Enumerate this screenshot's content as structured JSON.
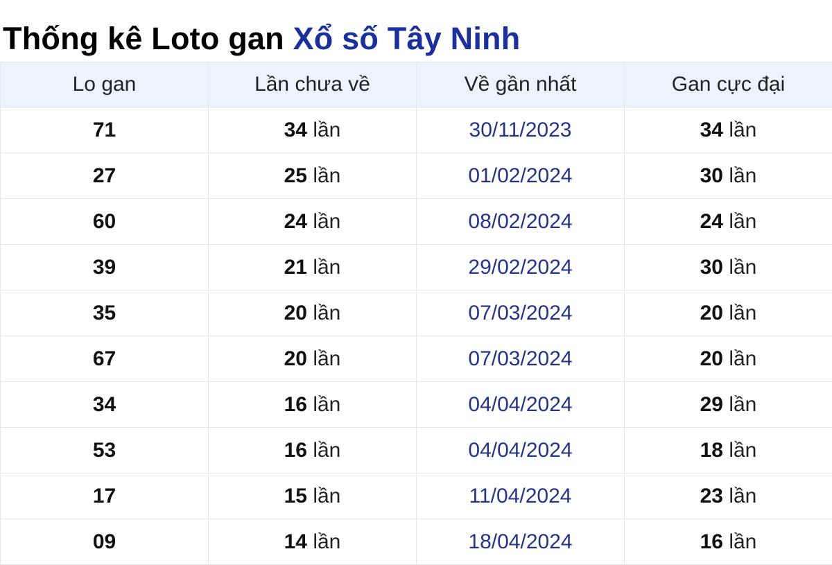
{
  "title": {
    "prefix": "Thống kê Loto gan",
    "link_text": "Xổ số Tây Ninh"
  },
  "colors": {
    "accent_link": "#1a2fa0",
    "date_link": "#24338f",
    "header_bg": "#ebf3fc",
    "border": "#e2e5ea"
  },
  "table": {
    "headers": [
      "Lo gan",
      "Lần chưa về",
      "Về gần nhất",
      "Gan cực đại"
    ],
    "unit": "lần",
    "rows": [
      {
        "lo": "71",
        "chua_ve": "34",
        "gan_nhat": "30/11/2023",
        "cuc_dai": "34"
      },
      {
        "lo": "27",
        "chua_ve": "25",
        "gan_nhat": "01/02/2024",
        "cuc_dai": "30"
      },
      {
        "lo": "60",
        "chua_ve": "24",
        "gan_nhat": "08/02/2024",
        "cuc_dai": "24"
      },
      {
        "lo": "39",
        "chua_ve": "21",
        "gan_nhat": "29/02/2024",
        "cuc_dai": "30"
      },
      {
        "lo": "35",
        "chua_ve": "20",
        "gan_nhat": "07/03/2024",
        "cuc_dai": "20"
      },
      {
        "lo": "67",
        "chua_ve": "20",
        "gan_nhat": "07/03/2024",
        "cuc_dai": "20"
      },
      {
        "lo": "34",
        "chua_ve": "16",
        "gan_nhat": "04/04/2024",
        "cuc_dai": "29"
      },
      {
        "lo": "53",
        "chua_ve": "16",
        "gan_nhat": "04/04/2024",
        "cuc_dai": "18"
      },
      {
        "lo": "17",
        "chua_ve": "15",
        "gan_nhat": "11/04/2024",
        "cuc_dai": "23"
      },
      {
        "lo": "09",
        "chua_ve": "14",
        "gan_nhat": "18/04/2024",
        "cuc_dai": "16"
      }
    ]
  }
}
